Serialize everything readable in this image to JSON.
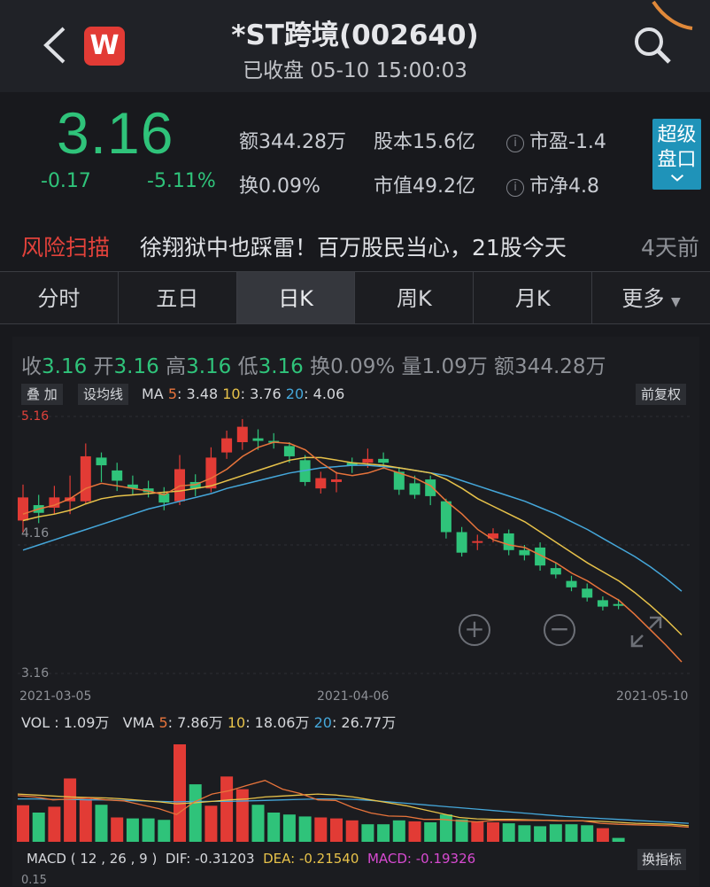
{
  "header": {
    "title": "*ST跨境(002640)",
    "status": "已收盘 05-10 15:00:03",
    "logo_text": "W"
  },
  "quote": {
    "price": "3.16",
    "change": "-0.17",
    "change_pct": "-5.11%",
    "amount": "额344.28万",
    "turnover": "换0.09%",
    "share_capital": "股本15.6亿",
    "market_cap": "市值49.2亿",
    "pe": "市盈-1.4",
    "pb": "市净4.8",
    "super_button": [
      "超级",
      "盘口"
    ]
  },
  "news": {
    "tag": "风险扫描",
    "headline": "徐翔狱中也踩雷！百万股民当心，21股今天",
    "time": "4天前"
  },
  "tabs": [
    "分时",
    "五日",
    "日K",
    "周K",
    "月K",
    "更多"
  ],
  "active_tab": "日K",
  "ohlc": {
    "close_label": "收",
    "close": "3.16",
    "open_label": "开",
    "open": "3.16",
    "high_label": "高",
    "high": "3.16",
    "low_label": "低",
    "low": "3.16",
    "turnover": "换0.09%",
    "volume": "量1.09万",
    "amount": "额344.28万"
  },
  "toolbar": {
    "overlay": "叠 加",
    "set_ma": "设均线",
    "adjust": "前复权",
    "indicator": "换指标"
  },
  "ma": {
    "label": "MA",
    "p5": "5",
    "v5": ": 3.48",
    "p10": "10",
    "v10": ": 3.76",
    "p20": "20",
    "v20": ": 4.06"
  },
  "vol": {
    "label": "VOL :",
    "value": "1.09万",
    "vma": "VMA",
    "p5": "5",
    "v5": ": 7.86万",
    "p10": "10",
    "v10": ": 18.06万",
    "p20": "20",
    "v20": ": 26.77万"
  },
  "macd": {
    "label": "MACD ( 12 , 26 , 9 )",
    "dif": "DIF: -0.31203",
    "dea": "DEA: -0.21540",
    "macd": "MACD: -0.19326"
  },
  "axis": {
    "top": "5.16",
    "mid": "4.16",
    "bottom": "3.16",
    "macd_tick": "0.15"
  },
  "dates": [
    "2021-03-05",
    "2021-04-06",
    "2021-05-10"
  ],
  "colors": {
    "up": "#e23b35",
    "down": "#2fc37a",
    "ma5": "#e8743b",
    "ma10": "#e7c24a",
    "ma20": "#45a7da"
  },
  "chart_data": {
    "type": "candlestick",
    "ylim": [
      3.16,
      5.16
    ],
    "candles": [
      {
        "o": 4.35,
        "c": 4.53,
        "h": 4.63,
        "l": 4.26
      },
      {
        "o": 4.47,
        "c": 4.41,
        "h": 4.55,
        "l": 4.33
      },
      {
        "o": 4.45,
        "c": 4.53,
        "h": 4.62,
        "l": 4.4
      },
      {
        "o": 4.5,
        "c": 4.53,
        "h": 4.7,
        "l": 4.4
      },
      {
        "o": 4.5,
        "c": 4.85,
        "h": 4.95,
        "l": 4.48
      },
      {
        "o": 4.84,
        "c": 4.78,
        "h": 4.88,
        "l": 4.65
      },
      {
        "o": 4.74,
        "c": 4.66,
        "h": 4.8,
        "l": 4.58
      },
      {
        "o": 4.63,
        "c": 4.6,
        "h": 4.7,
        "l": 4.55
      },
      {
        "o": 4.6,
        "c": 4.57,
        "h": 4.66,
        "l": 4.53
      },
      {
        "o": 4.56,
        "c": 4.49,
        "h": 4.61,
        "l": 4.43
      },
      {
        "o": 4.5,
        "c": 4.75,
        "h": 4.86,
        "l": 4.47
      },
      {
        "o": 4.65,
        "c": 4.6,
        "h": 4.71,
        "l": 4.54
      },
      {
        "o": 4.6,
        "c": 4.84,
        "h": 4.92,
        "l": 4.57
      },
      {
        "o": 4.88,
        "c": 4.99,
        "h": 5.05,
        "l": 4.83
      },
      {
        "o": 4.96,
        "c": 5.08,
        "h": 5.14,
        "l": 4.9
      },
      {
        "o": 4.99,
        "c": 4.97,
        "h": 5.06,
        "l": 4.9
      },
      {
        "o": 4.97,
        "c": 4.96,
        "h": 5.03,
        "l": 4.91
      },
      {
        "o": 4.93,
        "c": 4.85,
        "h": 4.96,
        "l": 4.8
      },
      {
        "o": 4.82,
        "c": 4.65,
        "h": 4.86,
        "l": 4.62
      },
      {
        "o": 4.6,
        "c": 4.68,
        "h": 4.73,
        "l": 4.56
      },
      {
        "o": 4.65,
        "c": 4.67,
        "h": 4.73,
        "l": 4.57
      },
      {
        "o": 4.8,
        "c": 4.78,
        "h": 4.84,
        "l": 4.72
      },
      {
        "o": 4.8,
        "c": 4.83,
        "h": 4.91,
        "l": 4.76
      },
      {
        "o": 4.83,
        "c": 4.8,
        "h": 4.88,
        "l": 4.75
      },
      {
        "o": 4.73,
        "c": 4.59,
        "h": 4.76,
        "l": 4.55
      },
      {
        "o": 4.64,
        "c": 4.55,
        "h": 4.7,
        "l": 4.52
      },
      {
        "o": 4.67,
        "c": 4.54,
        "h": 4.7,
        "l": 4.47
      },
      {
        "o": 4.5,
        "c": 4.26,
        "h": 4.52,
        "l": 4.21
      },
      {
        "o": 4.26,
        "c": 4.1,
        "h": 4.3,
        "l": 4.07
      },
      {
        "o": 4.18,
        "c": 4.19,
        "h": 4.24,
        "l": 4.12
      },
      {
        "o": 4.21,
        "c": 4.25,
        "h": 4.29,
        "l": 4.18
      },
      {
        "o": 4.25,
        "c": 4.12,
        "h": 4.28,
        "l": 4.08
      },
      {
        "o": 4.12,
        "c": 4.08,
        "h": 4.16,
        "l": 4.04
      },
      {
        "o": 4.14,
        "c": 4.0,
        "h": 4.18,
        "l": 3.96
      },
      {
        "o": 3.98,
        "c": 3.93,
        "h": 4.02,
        "l": 3.9
      },
      {
        "o": 3.88,
        "c": 3.83,
        "h": 3.92,
        "l": 3.8
      },
      {
        "o": 3.82,
        "c": 3.75,
        "h": 3.86,
        "l": 3.72
      },
      {
        "o": 3.73,
        "c": 3.68,
        "h": 3.76,
        "l": 3.65
      },
      {
        "o": 3.7,
        "c": 3.69,
        "h": 3.74,
        "l": 3.66
      }
    ],
    "ma5": [
      4.4,
      4.44,
      4.47,
      4.52,
      4.6,
      4.64,
      4.62,
      4.6,
      4.58,
      4.55,
      4.62,
      4.63,
      4.68,
      4.75,
      4.85,
      4.92,
      4.96,
      4.95,
      4.9,
      4.8,
      4.72,
      4.7,
      4.72,
      4.76,
      4.72,
      4.68,
      4.62,
      4.5,
      4.4,
      4.28,
      4.2,
      4.16,
      4.14,
      4.08,
      4.02,
      3.94,
      3.88,
      3.8,
      3.73,
      3.62,
      3.5,
      3.38,
      3.25
    ],
    "ma10": [
      4.35,
      4.38,
      4.4,
      4.43,
      4.48,
      4.52,
      4.54,
      4.55,
      4.56,
      4.57,
      4.58,
      4.6,
      4.62,
      4.66,
      4.7,
      4.74,
      4.78,
      4.82,
      4.84,
      4.84,
      4.82,
      4.8,
      4.79,
      4.78,
      4.76,
      4.74,
      4.72,
      4.67,
      4.6,
      4.52,
      4.46,
      4.4,
      4.34,
      4.26,
      4.18,
      4.1,
      4.02,
      3.95,
      3.88,
      3.79,
      3.69,
      3.58,
      3.46
    ],
    "ma20": [
      4.12,
      4.16,
      4.2,
      4.24,
      4.28,
      4.32,
      4.36,
      4.4,
      4.44,
      4.47,
      4.5,
      4.53,
      4.56,
      4.6,
      4.63,
      4.66,
      4.69,
      4.72,
      4.74,
      4.76,
      4.77,
      4.78,
      4.78,
      4.77,
      4.76,
      4.74,
      4.72,
      4.7,
      4.66,
      4.62,
      4.58,
      4.54,
      4.5,
      4.45,
      4.4,
      4.34,
      4.28,
      4.21,
      4.14,
      4.07,
      3.99,
      3.9,
      3.8
    ],
    "volume": [
      {
        "v": 7.5,
        "up": true
      },
      {
        "v": 6.0,
        "up": false
      },
      {
        "v": 7.2,
        "up": true
      },
      {
        "v": 13.0,
        "up": true
      },
      {
        "v": 8.8,
        "up": true
      },
      {
        "v": 7.6,
        "up": false
      },
      {
        "v": 5.0,
        "up": true
      },
      {
        "v": 4.8,
        "up": false
      },
      {
        "v": 4.8,
        "up": false
      },
      {
        "v": 4.5,
        "up": false
      },
      {
        "v": 20.0,
        "up": true
      },
      {
        "v": 11.8,
        "up": false
      },
      {
        "v": 7.4,
        "up": true
      },
      {
        "v": 13.4,
        "up": true
      },
      {
        "v": 10.8,
        "up": true
      },
      {
        "v": 7.6,
        "up": false
      },
      {
        "v": 6.0,
        "up": false
      },
      {
        "v": 5.6,
        "up": false
      },
      {
        "v": 5.2,
        "up": false
      },
      {
        "v": 5.0,
        "up": true
      },
      {
        "v": 4.8,
        "up": true
      },
      {
        "v": 4.4,
        "up": true
      },
      {
        "v": 3.6,
        "up": false
      },
      {
        "v": 3.6,
        "up": false
      },
      {
        "v": 4.4,
        "up": false
      },
      {
        "v": 4.2,
        "up": true
      },
      {
        "v": 4.0,
        "up": false
      },
      {
        "v": 5.6,
        "up": false
      },
      {
        "v": 4.6,
        "up": false
      },
      {
        "v": 4.2,
        "up": true
      },
      {
        "v": 4.0,
        "up": true
      },
      {
        "v": 3.8,
        "up": false
      },
      {
        "v": 3.4,
        "up": false
      },
      {
        "v": 3.2,
        "up": false
      },
      {
        "v": 3.6,
        "up": false
      },
      {
        "v": 3.6,
        "up": false
      },
      {
        "v": 3.4,
        "up": false
      },
      {
        "v": 2.8,
        "up": true
      },
      {
        "v": 0.8,
        "up": false
      }
    ],
    "vma5": [
      9.5,
      9.2,
      8.6,
      8.8,
      9.0,
      8.6,
      8.4,
      7.6,
      6.8,
      5.6,
      8.2,
      9.8,
      10.5,
      11.6,
      12.6,
      10.8,
      9.9,
      8.6,
      8.5,
      7.0,
      5.9,
      5.3,
      5.2,
      4.6,
      4.6,
      4.3,
      4.1,
      4.4,
      4.4,
      4.4,
      4.4,
      4.3,
      4.3,
      3.8,
      3.6,
      3.5,
      3.4,
      3.3,
      3.0
    ],
    "vma10": [
      9.8,
      9.6,
      9.4,
      9.2,
      9.1,
      9.0,
      8.8,
      8.5,
      8.2,
      7.8,
      8.0,
      8.3,
      8.6,
      8.8,
      9.2,
      9.4,
      9.6,
      9.8,
      9.6,
      9.2,
      8.6,
      8.0,
      7.4,
      6.6,
      5.8,
      5.0,
      4.7,
      4.6,
      4.6,
      4.5,
      4.4,
      4.3,
      4.3,
      4.2,
      4.0,
      3.8,
      3.7,
      3.6,
      3.3
    ],
    "vma20": [
      8.8,
      8.8,
      8.7,
      8.7,
      8.6,
      8.6,
      8.5,
      8.4,
      8.3,
      8.2,
      8.3,
      8.3,
      8.3,
      8.4,
      8.5,
      8.6,
      8.7,
      8.8,
      8.8,
      8.7,
      8.5,
      8.2,
      7.9,
      7.6,
      7.3,
      7.0,
      6.7,
      6.4,
      6.1,
      5.8,
      5.5,
      5.2,
      5.0,
      4.8,
      4.6,
      4.4,
      4.2,
      4.0,
      3.8
    ]
  }
}
